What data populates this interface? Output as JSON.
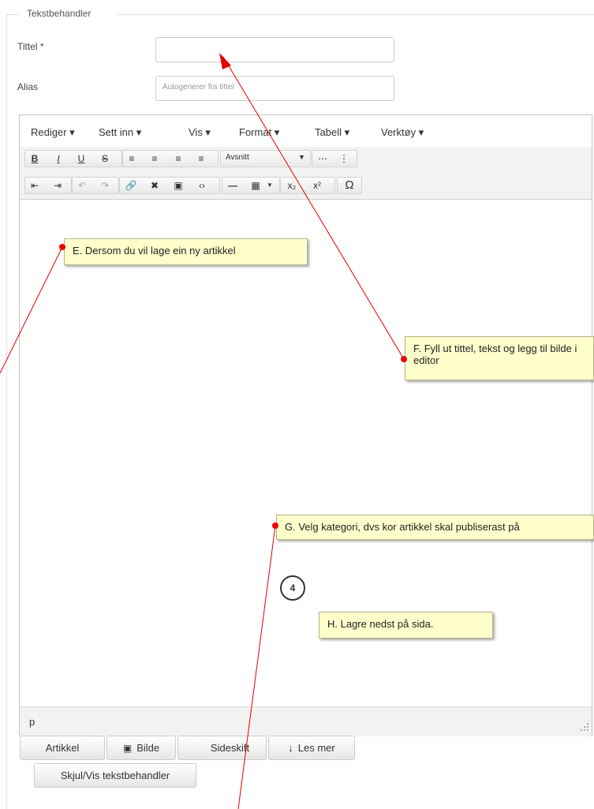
{
  "fieldset": {
    "legend": "Tekstbehandler"
  },
  "title_field": {
    "label": "Tittel *",
    "value": "",
    "placeholder": ""
  },
  "alias_field": {
    "label": "Alias",
    "value": "",
    "placeholder": "Autogenerer fra tittel"
  },
  "editor": {
    "menus": [
      "Rediger ▾",
      "Sett inn ▾",
      "Vis ▾",
      "Format ▾",
      "Tabell ▾",
      "Verktøy ▾"
    ],
    "format_select": "Avsnitt",
    "status_path": "p"
  },
  "buttons": {
    "artikkel": "Artikkel",
    "bilde": "Bilde",
    "sideskift": "Sideskift",
    "les_mer": "Les mer",
    "toggle_editor": "Skjul/Vis tekstbehandler"
  },
  "annotations": {
    "e": "E. Dersom du vil lage ein ny artikkel",
    "f": "F. Fyll ut tittel, tekst og legg til bilde i editor",
    "g": "G. Velg kategori, dvs kor artikkel skal publiserast på",
    "h": "H. Lagre nedst på sida.",
    "step_number": "4"
  },
  "colors": {
    "annotation_bg": "#ffffcc",
    "arrow": "#e00000"
  }
}
